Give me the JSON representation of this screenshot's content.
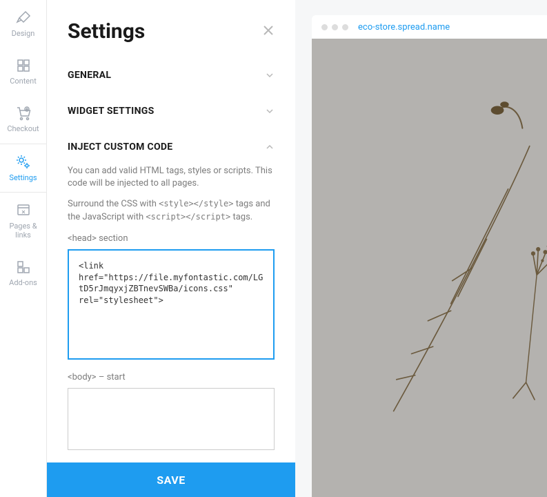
{
  "sidebar": {
    "items": [
      {
        "label": "Design"
      },
      {
        "label": "Content"
      },
      {
        "label": "Checkout"
      },
      {
        "label": "Settings"
      },
      {
        "label": "Pages & links"
      },
      {
        "label": "Add-ons"
      }
    ]
  },
  "panel": {
    "title": "Settings",
    "sections": {
      "general": {
        "title": "GENERAL"
      },
      "widget": {
        "title": "WIDGET SETTINGS"
      },
      "inject": {
        "title": "INJECT CUSTOM CODE",
        "desc1": "You can add valid HTML tags, styles or scripts. This code will be injected to all pages.",
        "desc2_pre": "Surround the CSS with ",
        "desc2_code1": "<style></style>",
        "desc2_mid": " tags and the JavaScript with ",
        "desc2_code2": "<script></script>",
        "desc2_post": " tags.",
        "head_label": "<head> section",
        "head_value": "<link href=\"https://file.myfontastic.com/LGtD5rJmqyxjZBTnevSWBa/icons.css\" rel=\"stylesheet\">",
        "body_label": "<body> – start"
      }
    },
    "save_label": "SAVE"
  },
  "preview": {
    "url": "eco-store.spread.name"
  }
}
